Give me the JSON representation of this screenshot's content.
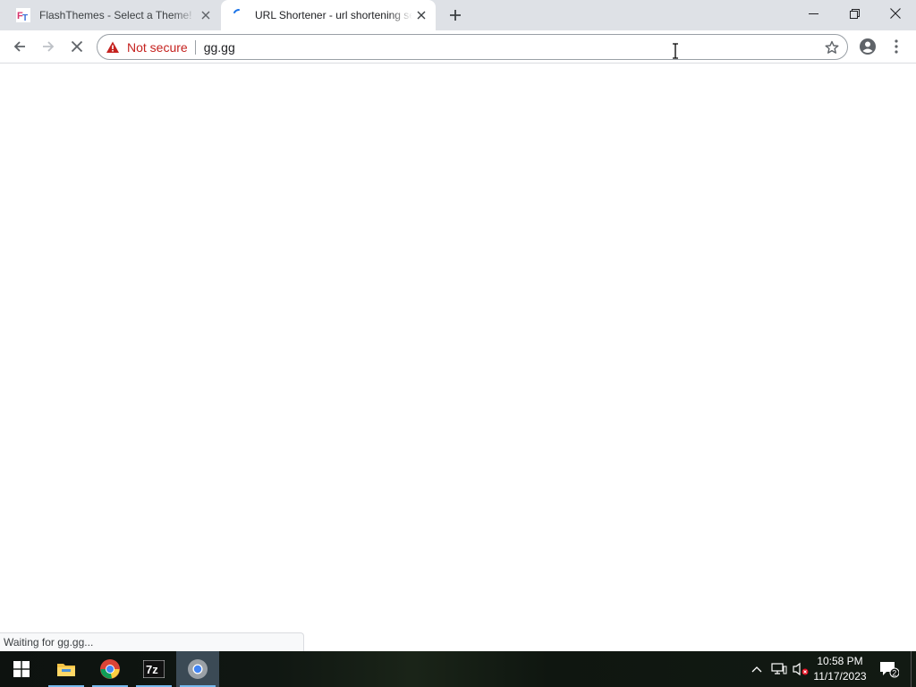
{
  "browser": {
    "tabs": [
      {
        "title": "FlashThemes - Select a Theme!",
        "favicon": "flashthemes-logo-icon",
        "active": false
      },
      {
        "title": "URL Shortener - url shortening service",
        "favicon": "loading-spinner-icon",
        "active": true
      }
    ],
    "omnibox": {
      "security_label": "Not secure",
      "url": "gg.gg"
    },
    "status_text": "Waiting for gg.gg..."
  },
  "taskbar": {
    "apps": [
      {
        "name": "start-icon"
      },
      {
        "name": "file-explorer-icon"
      },
      {
        "name": "chrome-icon"
      },
      {
        "name": "7zip-icon",
        "label": "7z"
      },
      {
        "name": "chrome-icon",
        "active": true
      }
    ],
    "clock": {
      "time": "10:58 PM",
      "date": "11/17/2023"
    },
    "notifications_count": "2"
  },
  "colors": {
    "tabstrip": "#dee1e6",
    "warning_red": "#c5221f",
    "taskbar_active_underline": "#76b9ed"
  }
}
